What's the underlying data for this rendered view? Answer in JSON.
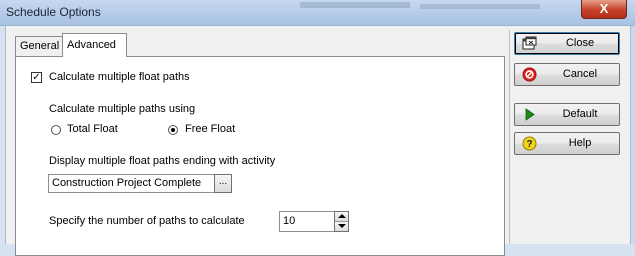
{
  "window": {
    "title": "Schedule Options",
    "close_glyph": "X"
  },
  "tabs": [
    {
      "label": "General"
    },
    {
      "label": "Advanced"
    }
  ],
  "advanced": {
    "calc_multiple_checkbox": {
      "label": "Calculate multiple float paths",
      "checked": true
    },
    "calc_using_label": "Calculate multiple paths using",
    "radio_total_float": {
      "label": "Total Float",
      "selected": false
    },
    "radio_free_float": {
      "label": "Free Float",
      "selected": true
    },
    "ending_activity_label": "Display multiple float paths ending with activity",
    "ending_activity_value": "Construction Project Complete",
    "browse_label": "...",
    "num_paths_label": "Specify the number of paths to calculate",
    "num_paths_value": "10"
  },
  "buttons": {
    "close": {
      "label": "Close",
      "icon": "close-window-icon"
    },
    "cancel": {
      "label": "Cancel",
      "icon": "cancel-icon"
    },
    "default": {
      "label": "Default",
      "icon": "play-icon"
    },
    "help": {
      "label": "Help",
      "icon": "help-icon"
    }
  },
  "colors": {
    "cancel_red": "#e0201b",
    "default_green": "#1b8a1b",
    "help_yellow": "#f2d516"
  }
}
